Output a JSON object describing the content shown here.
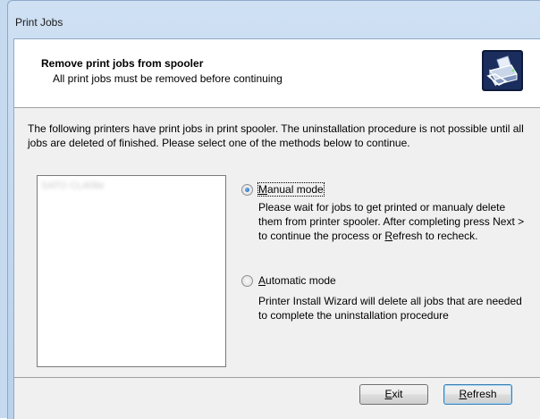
{
  "window": {
    "title": "Print Jobs"
  },
  "header": {
    "title": "Remove print jobs from spooler",
    "subtitle": "All print jobs must be removed before continuing",
    "icon": "printer-icon"
  },
  "intro_text": "The following printers have print jobs in print spooler. The uninstallation procedure is not possible until all jobs are deleted of finished. Please select one of the methods below to continue.",
  "printer_list": {
    "items": [
      "SATO CL408e"
    ]
  },
  "modes": [
    {
      "label": "Manual mode",
      "underline_char": "M",
      "selected": true,
      "description": "Please wait for jobs to get printed or manualy delete them from printer spooler. After completing press Next > to continue the process or Refresh to recheck."
    },
    {
      "label": "Automatic mode",
      "underline_char": "A",
      "selected": false,
      "description": "Printer Install Wizard will delete all jobs that are needed to complete the uninstallation procedure"
    }
  ],
  "buttons": {
    "exit": "Exit",
    "refresh": "Refresh"
  }
}
